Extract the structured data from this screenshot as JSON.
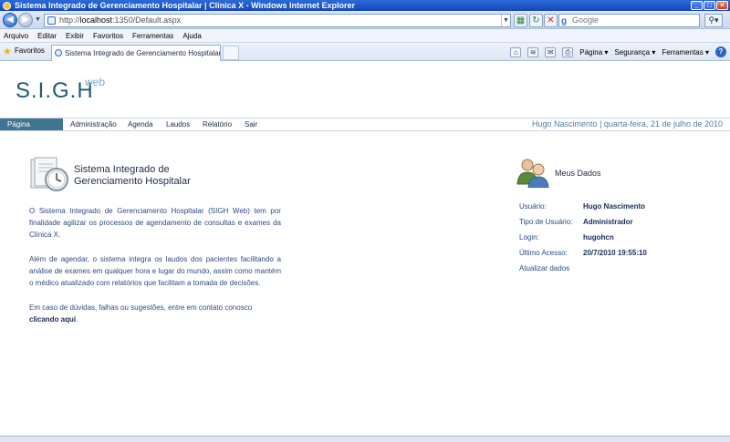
{
  "window": {
    "title": "Sistema Integrado de Gerenciamento Hospitalar | Clínica X - Windows Internet Explorer"
  },
  "address": {
    "url_prefix": "http://",
    "url_host": "localhost",
    "url_rest": ":1350/Default.aspx",
    "search_placeholder": "Google",
    "search_logo": "g"
  },
  "menu": [
    "Arquivo",
    "Editar",
    "Exibir",
    "Favoritos",
    "Ferramentas",
    "Ajuda"
  ],
  "favorites": {
    "label": "Favoritos",
    "tab_title": "Sistema Integrado de Gerenciamento Hospitalar | Clíni..."
  },
  "command_bar": {
    "page": "Página",
    "security": "Segurança",
    "tools": "Ferramentas",
    "help": "?"
  },
  "site": {
    "logo": "S.I.G.H",
    "logo_suffix": "web",
    "nav": [
      "Página Principal",
      "Administração",
      "Agenda",
      "Laudos",
      "Relatório",
      "Sair"
    ],
    "user_line": "Hugo Nascimento | quarta-feira, 21 de julho de 2010"
  },
  "intro": {
    "title_line1": "Sistema Integrado de",
    "title_line2": "Gerenciamento  Hospitalar",
    "p1": "O Sistema Integrado de Gerenciamento Hospitalar (SIGH Web) tem por finalidade agilizar os processos de agendamento de consultas e exames da Clínica X.",
    "p2": "Além de agendar, o sistema integra os laudos dos pacientes facilitando a análise de exames em qualquer hora e lugar do mundo, assim como mantém o médico atualizado com relatórios que facilitam a tomada de decisões.",
    "p3_text": "Em caso de dúvidas, falhas ou sugestões, entre em contato conosco ",
    "p3_link": "clicando aqui",
    "p3_end": "."
  },
  "meus_dados": {
    "title": "Meus Dados",
    "usuario_label": "Usuário:",
    "usuario": "Hugo Nascimento",
    "tipo_label": "Tipo de Usuário:",
    "tipo": "Administrador",
    "login_label": "Login:",
    "login": "hugohcn",
    "acesso_label": "Último Acesso:",
    "acesso": "20/7/2010 19:55:10",
    "update": "Atualizar dados"
  }
}
